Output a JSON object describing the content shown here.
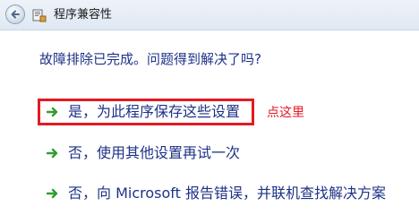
{
  "window": {
    "title": "程序兼容性"
  },
  "main": {
    "heading": "故障排除已完成。问题得到解决了吗?",
    "options": [
      {
        "label": "是，为此程序保存这些设置"
      },
      {
        "label": "否，使用其他设置再试一次"
      },
      {
        "label": "否，向 Microsoft 报告错误，并联机查找解决方案"
      }
    ]
  },
  "annotation": {
    "text": "点这里",
    "color": "#e21b23"
  },
  "colors": {
    "link_text": "#1e3287",
    "arrow_green": "#2f9e2f"
  },
  "icons": {
    "back": "back-arrow-icon",
    "app": "program-compatibility-icon",
    "option_arrow": "green-arrow-icon"
  }
}
